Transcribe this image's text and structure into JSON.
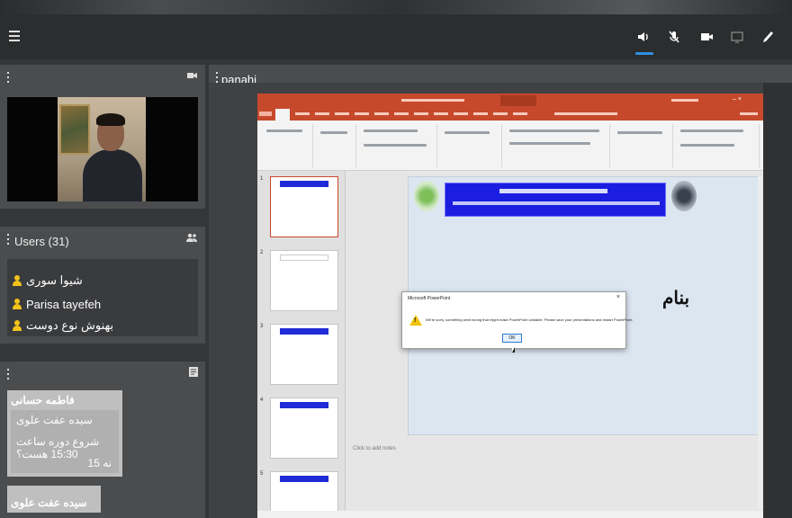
{
  "toolbar": {
    "icons": [
      "menu-icon",
      "speaker-icon",
      "mic-muted-icon",
      "camera-icon",
      "screen-share-icon",
      "pen-icon"
    ],
    "accent": "#2f8fe0"
  },
  "webcam_panel": {
    "icon": "camera-icon"
  },
  "users_panel": {
    "title": "Users (31)",
    "users": [
      "شیوا سوری",
      "Parisa tayefeh",
      "بهنوش نوع دوست"
    ]
  },
  "chat_panel": {
    "messages": [
      {
        "author": "فاطمه حسانی",
        "lines": [
          "سیده عفت علوی",
          "شروع دوره ساعت 15:30 هست؟",
          "نه 15"
        ]
      },
      {
        "author": "سیده عفت علوی",
        "lines": []
      }
    ]
  },
  "share": {
    "title": "panahi",
    "slide_text": "بنام",
    "notes_placeholder": "Click to add notes",
    "dialog": {
      "title": "Microsoft PowerPoint",
      "message": "We're sorry, something went wrong that might make PowerPoint unstable. Please save your presentations and restart PowerPoint.",
      "ok": "OK"
    }
  }
}
